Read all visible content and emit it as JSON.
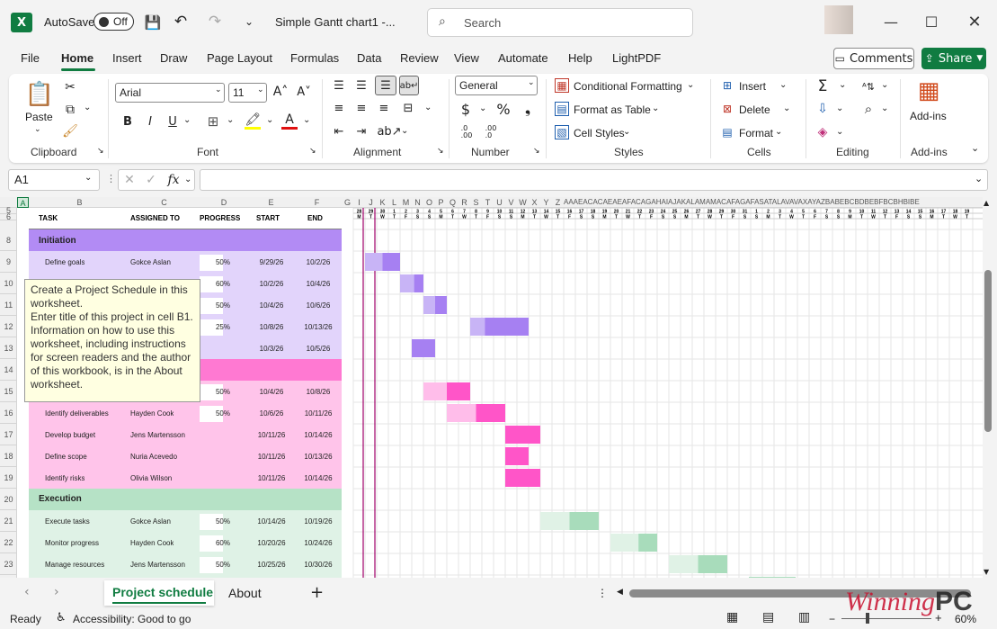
{
  "titlebar": {
    "autosave_label": "AutoSave",
    "autosave_state": "Off",
    "doc_title": "Simple Gantt chart1  -...",
    "search_placeholder": "Search"
  },
  "tabs": [
    "File",
    "Home",
    "Insert",
    "Draw",
    "Page Layout",
    "Formulas",
    "Data",
    "Review",
    "View",
    "Automate",
    "Help",
    "LightPDF"
  ],
  "active_tab": "Home",
  "buttons": {
    "comments": "Comments",
    "share": "Share"
  },
  "ribbon": {
    "clipboard": {
      "paste": "Paste",
      "label": "Clipboard"
    },
    "font": {
      "name": "Arial",
      "size": "11",
      "label": "Font"
    },
    "alignment": {
      "label": "Alignment"
    },
    "number": {
      "format": "General",
      "label": "Number"
    },
    "styles": {
      "conditional": "Conditional Formatting",
      "table": "Format as Table",
      "cell": "Cell Styles",
      "label": "Styles"
    },
    "cells": {
      "insert": "Insert",
      "delete": "Delete",
      "format": "Format",
      "label": "Cells"
    },
    "editing": {
      "label": "Editing"
    },
    "addins": {
      "button": "Add-ins",
      "label": "Add-ins"
    }
  },
  "formula_bar": {
    "name_box": "A1",
    "formula": ""
  },
  "columns": {
    "labels": [
      "A",
      "B",
      "C",
      "D",
      "E",
      "F",
      "G",
      "I",
      "J",
      "K",
      "L",
      "M",
      "N",
      "O",
      "P",
      "Q",
      "R",
      "S",
      "T",
      "U",
      "V",
      "W",
      "X",
      "Y",
      "Z",
      "AAAEACACAEAEAFACAGAHAIAJAKALAMAMACAFAGAFASATALAVAVAXAYAZBABEBCBDBEBFBCBHBIBE"
    ]
  },
  "rows": {
    "labels": [
      "5",
      "6",
      "8",
      "9",
      "10",
      "11",
      "12",
      "13",
      "14",
      "15",
      "16",
      "17",
      "18",
      "19",
      "20",
      "21",
      "22",
      "23"
    ]
  },
  "headers": {
    "task": "TASK",
    "assigned": "ASSIGNED TO",
    "progress": "PROGRESS",
    "start": "START",
    "end": "END"
  },
  "phases": {
    "initiation": "Initiation",
    "execution": "Execution"
  },
  "tasks": [
    {
      "name": "Define goals",
      "assigned": "Gokce Aslan",
      "progress": "50%",
      "start": "9/29/26",
      "end": "10/2/26"
    },
    {
      "name": "",
      "assigned": "",
      "progress": "60%",
      "start": "10/2/26",
      "end": "10/4/26"
    },
    {
      "name": "",
      "assigned": "",
      "progress": "50%",
      "start": "10/4/26",
      "end": "10/6/26"
    },
    {
      "name": "",
      "assigned": "",
      "progress": "25%",
      "start": "10/8/26",
      "end": "10/13/26"
    },
    {
      "name": "",
      "assigned": "",
      "progress": "",
      "start": "10/3/26",
      "end": "10/5/26"
    },
    {
      "name": "",
      "assigned": "",
      "progress": "50%",
      "start": "10/4/26",
      "end": "10/8/26"
    },
    {
      "name": "Identify deliverables",
      "assigned": "Hayden Cook",
      "progress": "50%",
      "start": "10/6/26",
      "end": "10/11/26"
    },
    {
      "name": "Develop budget",
      "assigned": "Jens Martensson",
      "progress": "",
      "start": "10/11/26",
      "end": "10/14/26"
    },
    {
      "name": "Define scope",
      "assigned": "Nuria Acevedo",
      "progress": "",
      "start": "10/11/26",
      "end": "10/13/26"
    },
    {
      "name": "Identify risks",
      "assigned": "Olivia Wilson",
      "progress": "",
      "start": "10/11/26",
      "end": "10/14/26"
    },
    {
      "name": "Execute tasks",
      "assigned": "Gokce Aslan",
      "progress": "50%",
      "start": "10/14/26",
      "end": "10/19/26"
    },
    {
      "name": "Monitor progress",
      "assigned": "Hayden Cook",
      "progress": "60%",
      "start": "10/20/26",
      "end": "10/24/26"
    },
    {
      "name": "Manage resources",
      "assigned": "Jens Martensson",
      "progress": "50%",
      "start": "10/25/26",
      "end": "10/30/26"
    }
  ],
  "timeline": {
    "days": [
      "28",
      "29",
      "30",
      "1",
      "2",
      "3",
      "4",
      "5",
      "6",
      "7",
      "8",
      "9",
      "10",
      "11",
      "12",
      "13",
      "14",
      "15",
      "16",
      "17",
      "18",
      "19",
      "20",
      "21",
      "22",
      "23",
      "24",
      "25",
      "26",
      "27",
      "28",
      "29",
      "30",
      "31",
      "1",
      "2",
      "3",
      "4",
      "5",
      "6",
      "7",
      "8",
      "9",
      "10",
      "11",
      "12",
      "13",
      "14",
      "15",
      "16",
      "17",
      "18",
      "19"
    ],
    "weekdays": [
      "M",
      "T",
      "W",
      "T",
      "F",
      "S",
      "S",
      "M",
      "T",
      "W",
      "T",
      "F",
      "S",
      "S",
      "M",
      "T",
      "W",
      "T",
      "F",
      "S",
      "S",
      "M",
      "T",
      "W",
      "T",
      "F",
      "S",
      "S",
      "M",
      "T",
      "W",
      "T",
      "F",
      "S",
      "S",
      "M",
      "T",
      "W",
      "T",
      "F",
      "S",
      "S",
      "M",
      "T",
      "W",
      "T",
      "F",
      "S",
      "S",
      "M",
      "T",
      "W",
      "T"
    ]
  },
  "tooltip": "Create a Project Schedule in this worksheet.\nEnter title of this project in cell B1. Information on how to use this worksheet, including instructions for screen readers and the author of this workbook, is in the About worksheet.",
  "sheets": [
    "Project schedule",
    "About"
  ],
  "status": {
    "ready": "Ready",
    "accessibility": "Accessibility: Good to go",
    "zoom": "60%"
  },
  "watermark": {
    "a": "Winning",
    "b": "PC"
  },
  "colors": {
    "accent": "#107c41",
    "initiation": "#a680f2",
    "planning": "#ff55c8",
    "execution": "#a8dcbb",
    "today_line": "#a0006a"
  }
}
